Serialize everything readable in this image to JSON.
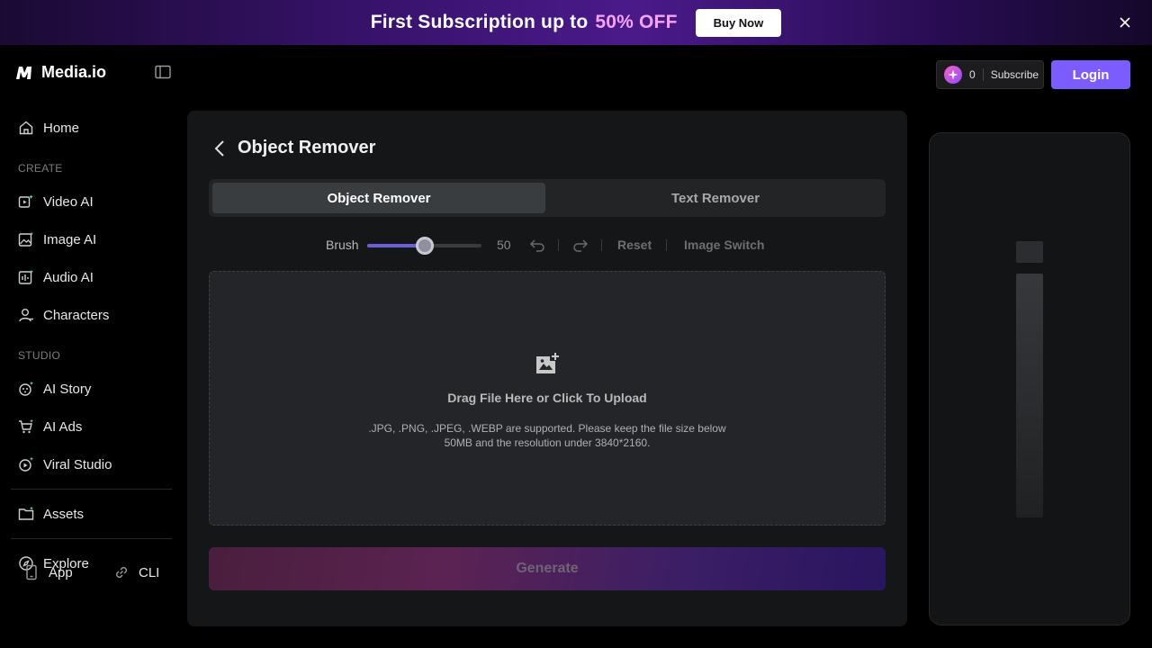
{
  "banner": {
    "text": "First Subscription up to",
    "highlight": "50% OFF",
    "button_label": "Buy Now",
    "close_icon": "close-icon"
  },
  "app": {
    "name": "Media.io"
  },
  "sidebar": {
    "home": "Home",
    "create_section": "CREATE",
    "create_items": [
      "Video AI",
      "Image AI",
      "Audio AI",
      "Characters"
    ],
    "studio_section": "STUDIO",
    "studio_items": [
      "AI Story",
      "AI Ads",
      "Viral Studio"
    ],
    "assets": "Assets",
    "explore": "Explore",
    "footer": [
      "App",
      "CLI"
    ]
  },
  "header": {
    "credits": "0",
    "subscribe_label": "Subscribe",
    "login_label": "Login"
  },
  "main": {
    "title": "Object Remover",
    "tabs": [
      {
        "label": "Object Remover",
        "active": true
      },
      {
        "label": "Text Remover",
        "active": false
      }
    ],
    "toolbar": {
      "brush_label": "Brush",
      "brush_value": "50",
      "brush_fraction": 0.5,
      "reset_label": "Reset",
      "switch_label": "Image Switch"
    },
    "upload": {
      "title": "Drag File Here or Click To Upload",
      "hint": ".JPG, .PNG, .JPEG, .WEBP are supported. Please keep the file size below 50MB and the resolution under 3840*2160."
    },
    "generate_label": "Generate"
  },
  "colors": {
    "accent": "#7b5cff",
    "slider_fill": "#6a5fd8",
    "banner_highlight": "#f5a3ff"
  }
}
